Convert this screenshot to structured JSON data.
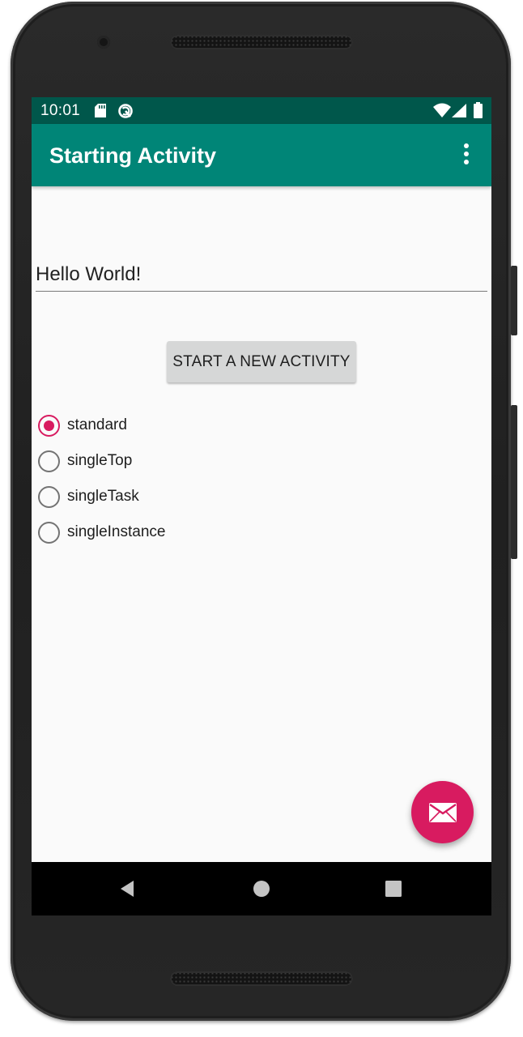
{
  "status_bar": {
    "time": "10:01",
    "icons": [
      "sd-card-icon",
      "sync-icon",
      "wifi-icon",
      "signal-icon",
      "battery-icon"
    ]
  },
  "app_bar": {
    "title": "Starting Activity",
    "menu_icon": "more-vert-icon"
  },
  "main": {
    "text_field_value": "Hello World!",
    "start_button_label": "START A NEW ACTIVITY",
    "launch_modes": [
      {
        "label": "standard",
        "checked": true
      },
      {
        "label": "singleTop",
        "checked": false
      },
      {
        "label": "singleTask",
        "checked": false
      },
      {
        "label": "singleInstance",
        "checked": false
      }
    ]
  },
  "fab": {
    "icon": "email-icon"
  },
  "nav_bar": {
    "icons": [
      "back-icon",
      "home-icon",
      "recents-icon"
    ]
  },
  "colors": {
    "status_bar": "#00574b",
    "app_bar": "#008577",
    "accent": "#d81b60",
    "background": "#fafafa"
  }
}
